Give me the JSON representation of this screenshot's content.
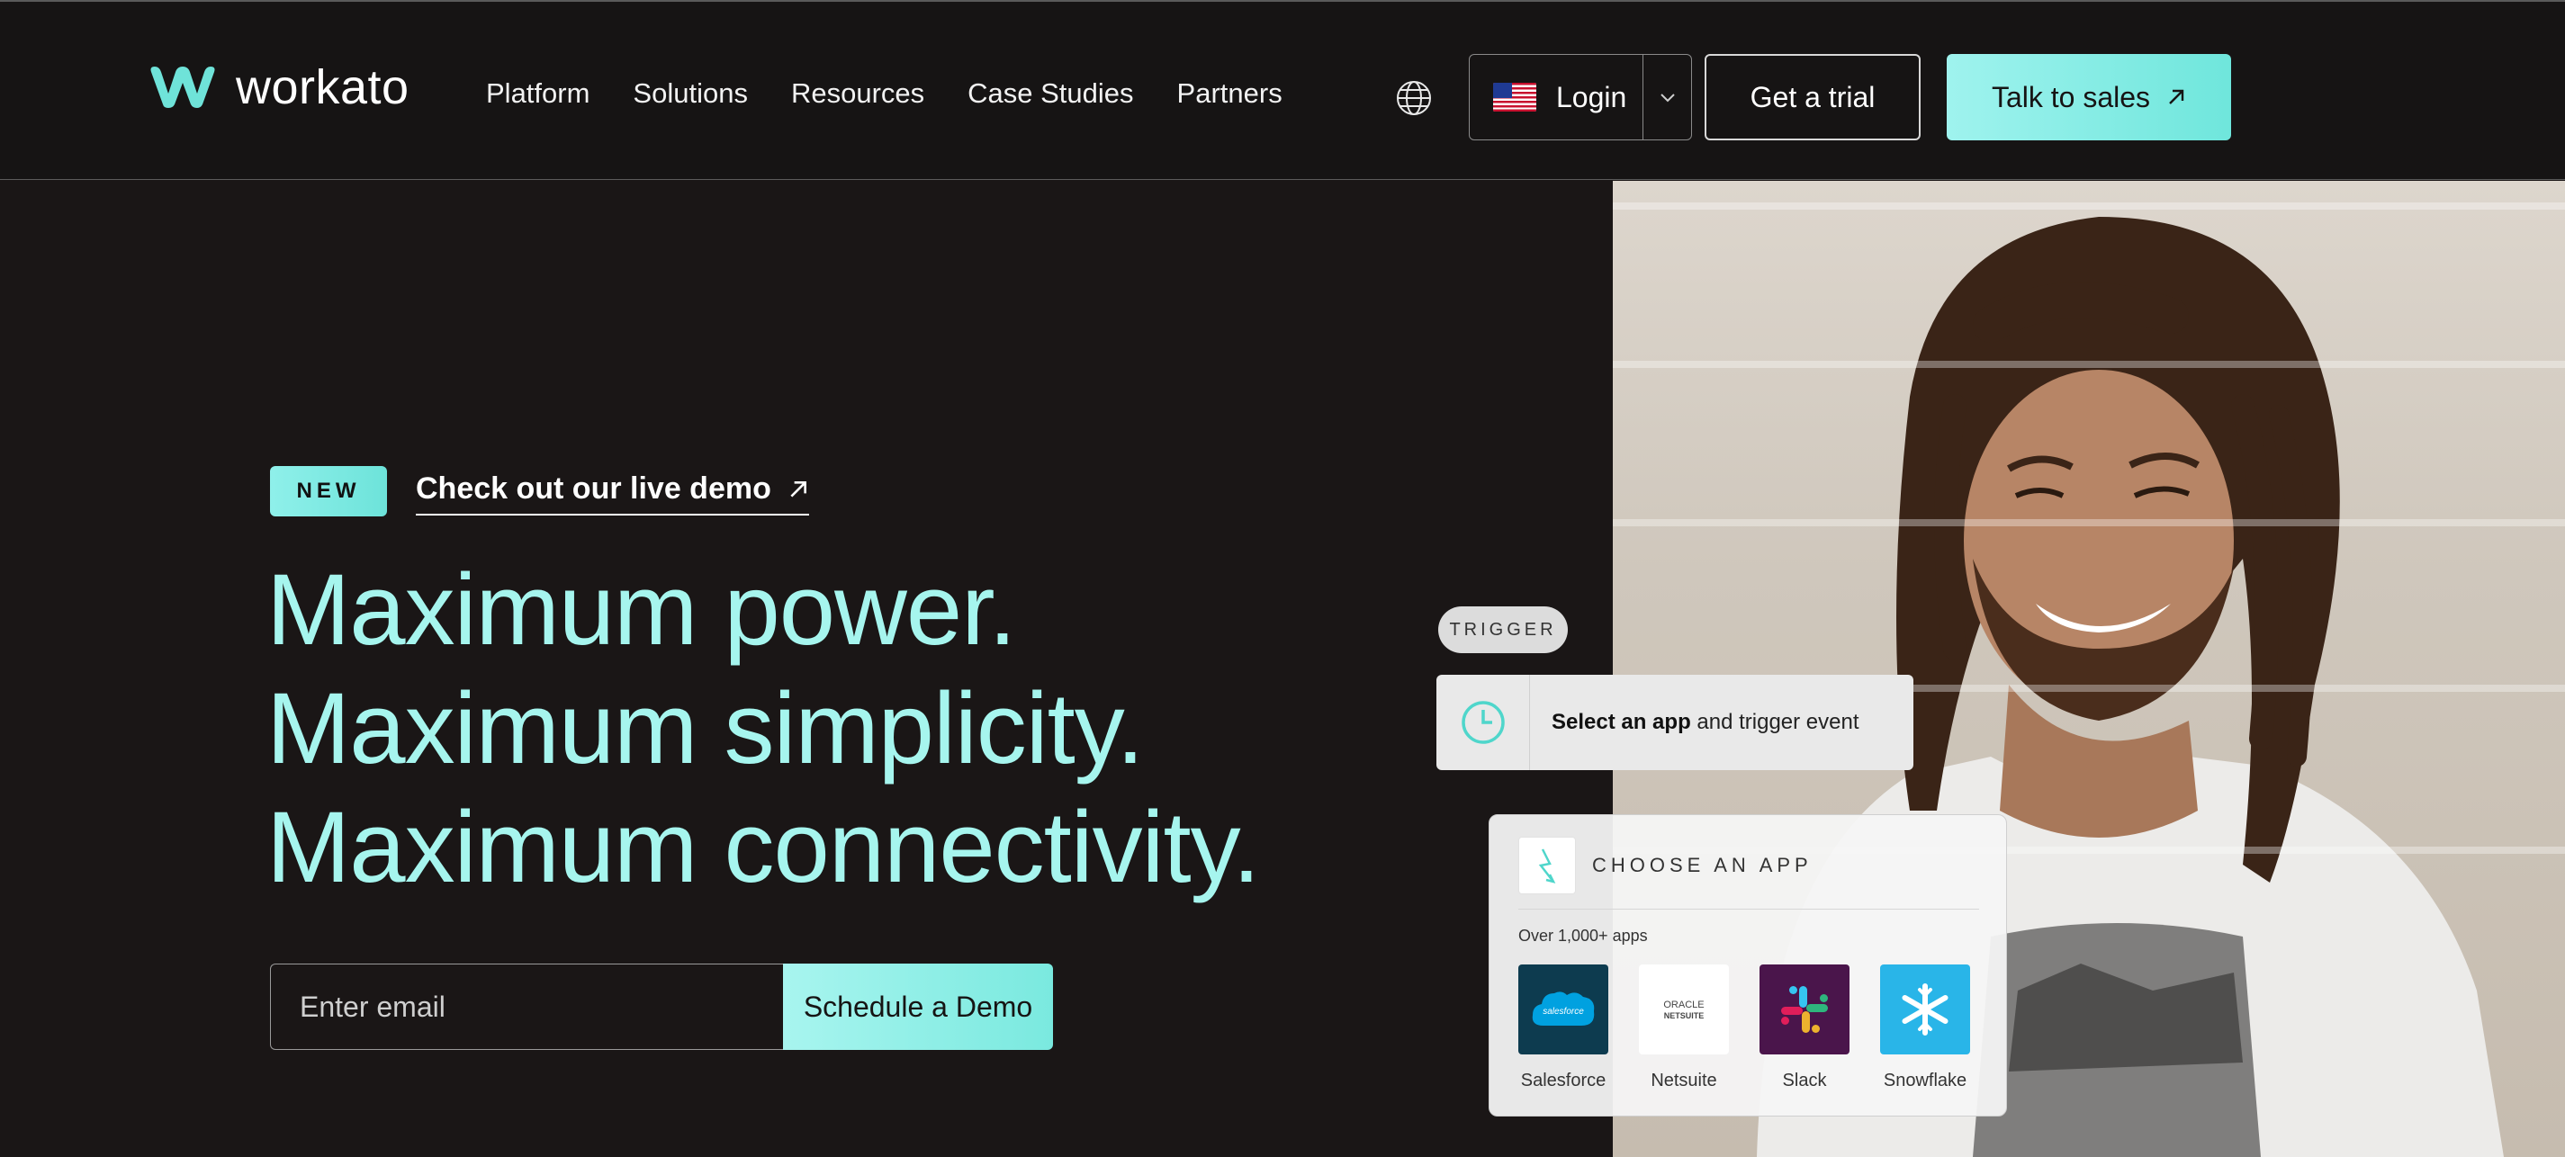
{
  "header": {
    "brand": "workato",
    "nav": [
      "Platform",
      "Solutions",
      "Resources",
      "Case Studies",
      "Partners"
    ],
    "login_label": "Login",
    "trial_label": "Get a trial",
    "sales_label": "Talk to sales"
  },
  "hero": {
    "badge": "NEW",
    "demo_link": "Check out our live demo",
    "headline": [
      "Maximum power.",
      "Maximum simplicity.",
      "Maximum connectivity."
    ],
    "email_placeholder": "Enter email",
    "cta": "Schedule a Demo"
  },
  "workflow": {
    "trigger_label": "TRIGGER",
    "trigger_bold": "Select an app",
    "trigger_rest": " and trigger event",
    "choose_title": "CHOOSE AN APP",
    "apps_count": "Over 1,000+ apps",
    "apps": [
      {
        "name": "Salesforce",
        "logo_text": "salesforce"
      },
      {
        "name": "Netsuite",
        "logo_text": "ORACLE NETSUITE"
      },
      {
        "name": "Slack",
        "logo_text": ""
      },
      {
        "name": "Snowflake",
        "logo_text": ""
      }
    ]
  },
  "colors": {
    "accent": "#a6f5ee",
    "button_gradient_start": "#9ff3ee",
    "button_gradient_end": "#6fe6dc",
    "background": "#1a1616",
    "salesforce": "#0d3b4f",
    "slack": "#4a154b",
    "snowflake": "#29b5e8"
  },
  "icons": {
    "logo": "workato-logo-icon",
    "globe": "globe-icon",
    "flag": "us-flag-icon",
    "caret": "chevron-down-icon",
    "arrow": "arrow-up-right-icon",
    "trigger": "clock-icon",
    "choose_app": "bolt-icon"
  }
}
